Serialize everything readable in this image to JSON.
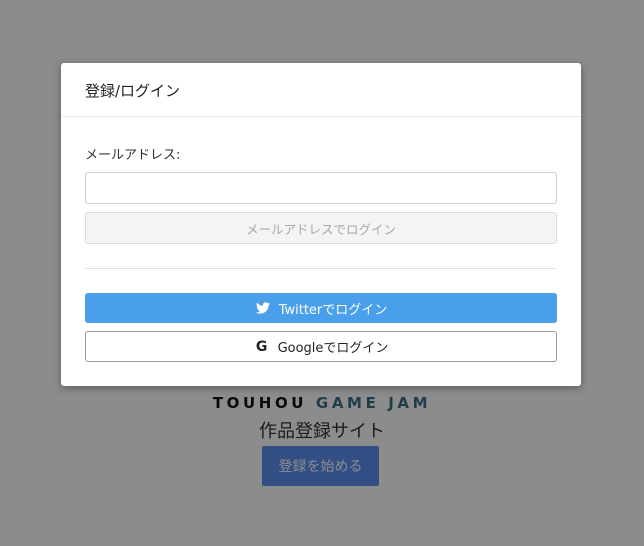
{
  "landing": {
    "logo_part1": "TOUHOU",
    "logo_part2": "GAME JAM",
    "subtitle": "作品登録サイト",
    "start_button": "登録を始める"
  },
  "modal": {
    "title": "登録/ログイン",
    "email_label": "メールアドレス:",
    "email_value": "",
    "email_login_button": "メールアドレスでログイン",
    "twitter_button": "Twitterでログイン",
    "google_button": "Googleでログイン"
  },
  "icons": {
    "twitter": "twitter-bird-icon",
    "google": "google-g-icon"
  },
  "colors": {
    "overlay": "#8a8a8a",
    "twitter": "#4a9fea",
    "start_button": "#5b8ff0",
    "logo_accent": "#3c6f8b"
  }
}
